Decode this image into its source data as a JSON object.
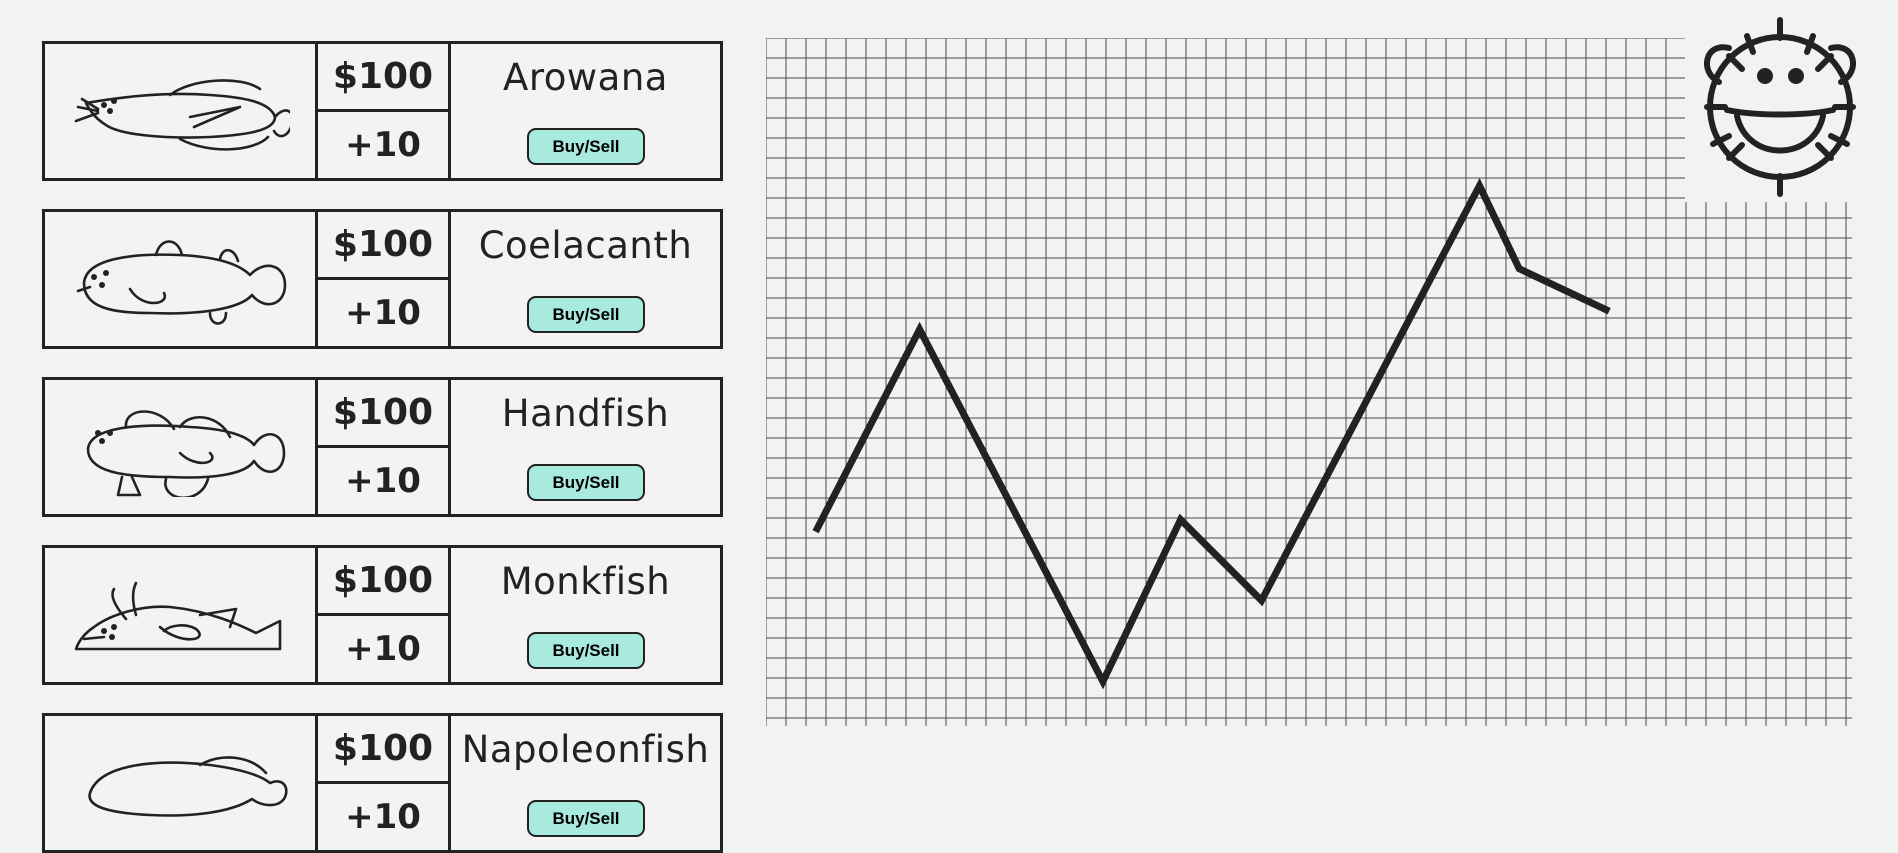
{
  "fish": [
    {
      "name": "Arowana",
      "price": "$100",
      "income": "+10",
      "button": "Buy/Sell",
      "icon": "arowana-icon"
    },
    {
      "name": "Coelacanth",
      "price": "$100",
      "income": "+10",
      "button": "Buy/Sell",
      "icon": "coelacanth-icon"
    },
    {
      "name": "Handfish",
      "price": "$100",
      "income": "+10",
      "button": "Buy/Sell",
      "icon": "handfish-icon"
    },
    {
      "name": "Monkfish",
      "price": "$100",
      "income": "+10",
      "button": "Buy/Sell",
      "icon": "monkfish-icon"
    },
    {
      "name": "Napoleonfish",
      "price": "$100",
      "income": "+10",
      "button": "Buy/Sell",
      "icon": "napoleonfish-icon"
    }
  ],
  "mascot": {
    "icon": "pufferfish-face-icon"
  },
  "colors": {
    "button": "#a8eade",
    "ink": "#222222",
    "background": "#f2f2f2",
    "grid": "#4a4a4a"
  },
  "chart_data": {
    "type": "line",
    "x": [
      0,
      1,
      2,
      3,
      4,
      5,
      6,
      7,
      8
    ],
    "series": [
      {
        "values": [
          9.6,
          19.6,
          2.2,
          10.2,
          6.2,
          26.7,
          22.6,
          20.5
        ]
      }
    ],
    "ylim": [
      0,
      34
    ],
    "xlim": [
      0,
      8
    ],
    "grid": true
  }
}
